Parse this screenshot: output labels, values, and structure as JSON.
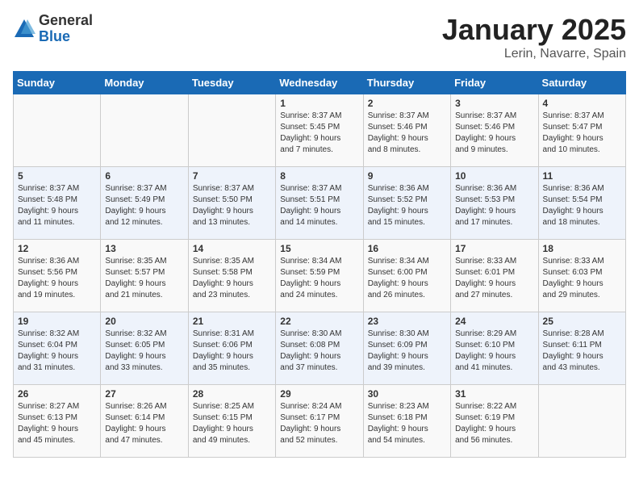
{
  "header": {
    "logo_general": "General",
    "logo_blue": "Blue",
    "title": "January 2025",
    "subtitle": "Lerin, Navarre, Spain"
  },
  "weekdays": [
    "Sunday",
    "Monday",
    "Tuesday",
    "Wednesday",
    "Thursday",
    "Friday",
    "Saturday"
  ],
  "weeks": [
    [
      {
        "day": "",
        "info": ""
      },
      {
        "day": "",
        "info": ""
      },
      {
        "day": "",
        "info": ""
      },
      {
        "day": "1",
        "info": "Sunrise: 8:37 AM\nSunset: 5:45 PM\nDaylight: 9 hours\nand 7 minutes."
      },
      {
        "day": "2",
        "info": "Sunrise: 8:37 AM\nSunset: 5:46 PM\nDaylight: 9 hours\nand 8 minutes."
      },
      {
        "day": "3",
        "info": "Sunrise: 8:37 AM\nSunset: 5:46 PM\nDaylight: 9 hours\nand 9 minutes."
      },
      {
        "day": "4",
        "info": "Sunrise: 8:37 AM\nSunset: 5:47 PM\nDaylight: 9 hours\nand 10 minutes."
      }
    ],
    [
      {
        "day": "5",
        "info": "Sunrise: 8:37 AM\nSunset: 5:48 PM\nDaylight: 9 hours\nand 11 minutes."
      },
      {
        "day": "6",
        "info": "Sunrise: 8:37 AM\nSunset: 5:49 PM\nDaylight: 9 hours\nand 12 minutes."
      },
      {
        "day": "7",
        "info": "Sunrise: 8:37 AM\nSunset: 5:50 PM\nDaylight: 9 hours\nand 13 minutes."
      },
      {
        "day": "8",
        "info": "Sunrise: 8:37 AM\nSunset: 5:51 PM\nDaylight: 9 hours\nand 14 minutes."
      },
      {
        "day": "9",
        "info": "Sunrise: 8:36 AM\nSunset: 5:52 PM\nDaylight: 9 hours\nand 15 minutes."
      },
      {
        "day": "10",
        "info": "Sunrise: 8:36 AM\nSunset: 5:53 PM\nDaylight: 9 hours\nand 17 minutes."
      },
      {
        "day": "11",
        "info": "Sunrise: 8:36 AM\nSunset: 5:54 PM\nDaylight: 9 hours\nand 18 minutes."
      }
    ],
    [
      {
        "day": "12",
        "info": "Sunrise: 8:36 AM\nSunset: 5:56 PM\nDaylight: 9 hours\nand 19 minutes."
      },
      {
        "day": "13",
        "info": "Sunrise: 8:35 AM\nSunset: 5:57 PM\nDaylight: 9 hours\nand 21 minutes."
      },
      {
        "day": "14",
        "info": "Sunrise: 8:35 AM\nSunset: 5:58 PM\nDaylight: 9 hours\nand 23 minutes."
      },
      {
        "day": "15",
        "info": "Sunrise: 8:34 AM\nSunset: 5:59 PM\nDaylight: 9 hours\nand 24 minutes."
      },
      {
        "day": "16",
        "info": "Sunrise: 8:34 AM\nSunset: 6:00 PM\nDaylight: 9 hours\nand 26 minutes."
      },
      {
        "day": "17",
        "info": "Sunrise: 8:33 AM\nSunset: 6:01 PM\nDaylight: 9 hours\nand 27 minutes."
      },
      {
        "day": "18",
        "info": "Sunrise: 8:33 AM\nSunset: 6:03 PM\nDaylight: 9 hours\nand 29 minutes."
      }
    ],
    [
      {
        "day": "19",
        "info": "Sunrise: 8:32 AM\nSunset: 6:04 PM\nDaylight: 9 hours\nand 31 minutes."
      },
      {
        "day": "20",
        "info": "Sunrise: 8:32 AM\nSunset: 6:05 PM\nDaylight: 9 hours\nand 33 minutes."
      },
      {
        "day": "21",
        "info": "Sunrise: 8:31 AM\nSunset: 6:06 PM\nDaylight: 9 hours\nand 35 minutes."
      },
      {
        "day": "22",
        "info": "Sunrise: 8:30 AM\nSunset: 6:08 PM\nDaylight: 9 hours\nand 37 minutes."
      },
      {
        "day": "23",
        "info": "Sunrise: 8:30 AM\nSunset: 6:09 PM\nDaylight: 9 hours\nand 39 minutes."
      },
      {
        "day": "24",
        "info": "Sunrise: 8:29 AM\nSunset: 6:10 PM\nDaylight: 9 hours\nand 41 minutes."
      },
      {
        "day": "25",
        "info": "Sunrise: 8:28 AM\nSunset: 6:11 PM\nDaylight: 9 hours\nand 43 minutes."
      }
    ],
    [
      {
        "day": "26",
        "info": "Sunrise: 8:27 AM\nSunset: 6:13 PM\nDaylight: 9 hours\nand 45 minutes."
      },
      {
        "day": "27",
        "info": "Sunrise: 8:26 AM\nSunset: 6:14 PM\nDaylight: 9 hours\nand 47 minutes."
      },
      {
        "day": "28",
        "info": "Sunrise: 8:25 AM\nSunset: 6:15 PM\nDaylight: 9 hours\nand 49 minutes."
      },
      {
        "day": "29",
        "info": "Sunrise: 8:24 AM\nSunset: 6:17 PM\nDaylight: 9 hours\nand 52 minutes."
      },
      {
        "day": "30",
        "info": "Sunrise: 8:23 AM\nSunset: 6:18 PM\nDaylight: 9 hours\nand 54 minutes."
      },
      {
        "day": "31",
        "info": "Sunrise: 8:22 AM\nSunset: 6:19 PM\nDaylight: 9 hours\nand 56 minutes."
      },
      {
        "day": "",
        "info": ""
      }
    ]
  ]
}
